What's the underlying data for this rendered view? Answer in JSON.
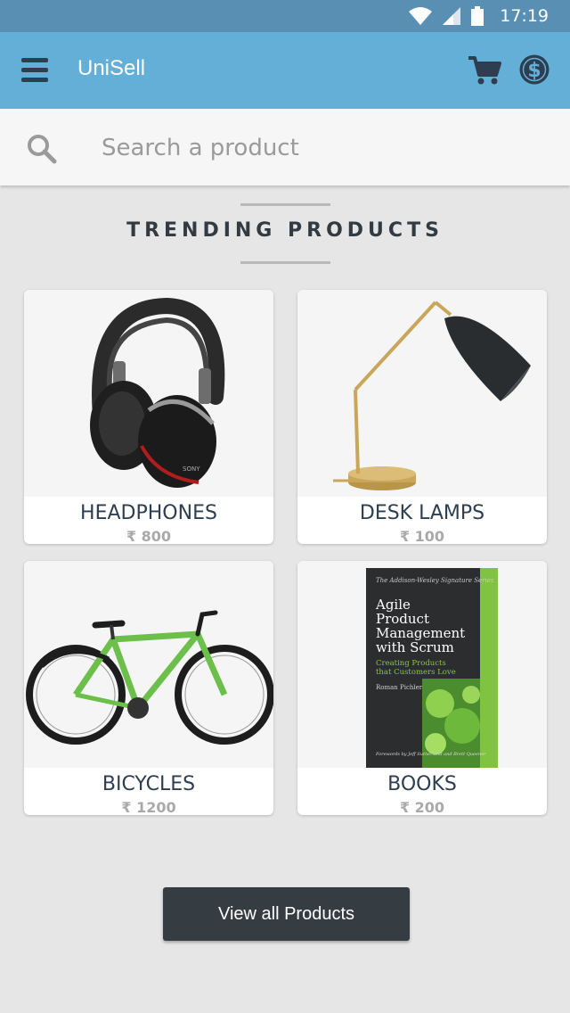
{
  "status_bar": {
    "time": "17:19"
  },
  "app_bar": {
    "title": "UniSell"
  },
  "search": {
    "placeholder": "Search a product"
  },
  "section": {
    "title": "TRENDING PRODUCTS"
  },
  "products": [
    {
      "name": "HEADPHONES",
      "price": "₹ 800",
      "image": "headphones-image"
    },
    {
      "name": "DESK LAMPS",
      "price": "₹ 100",
      "image": "desk-lamp-image"
    },
    {
      "name": "BICYCLES",
      "price": "₹ 1200",
      "image": "bicycle-image"
    },
    {
      "name": "BOOKS",
      "price": "₹ 200",
      "image": "book-image"
    }
  ],
  "book_cover": {
    "series": "The Addison-Wesley Signature Series",
    "title_lines": [
      "Agile",
      "Product",
      "Management",
      "with Scrum"
    ],
    "subtitle_lines": [
      "Creating Products",
      "that Customers Love"
    ],
    "author": "Roman Pichler",
    "forewords": "Forewords by Jeff Sutherland and Brett Queener"
  },
  "actions": {
    "view_all": "View all Products"
  },
  "colors": {
    "status_bar": "#5a8fb4",
    "app_bar": "#64afd8",
    "background": "#e6e6e6",
    "button": "#363d42"
  }
}
